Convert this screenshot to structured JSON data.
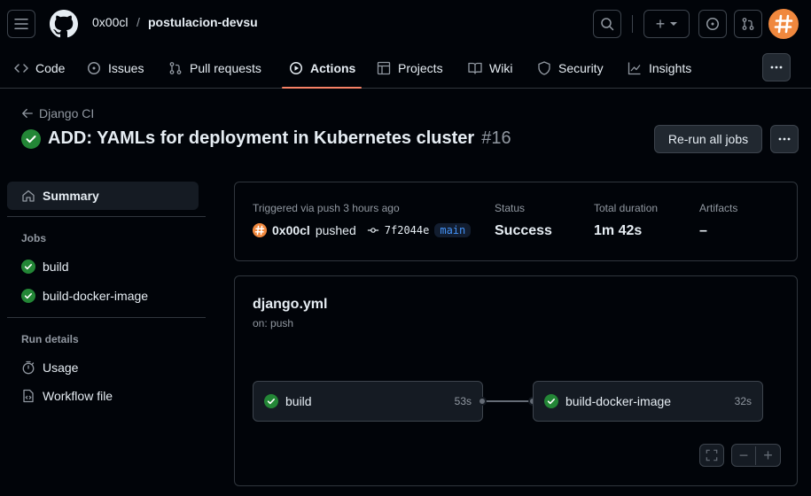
{
  "header": {
    "owner": "0x00cl",
    "separator": "/",
    "repo": "postulacion-devsu",
    "create_label": "+"
  },
  "tabs": [
    {
      "label": "Code",
      "icon": "code-icon"
    },
    {
      "label": "Issues",
      "icon": "issue-opened-icon"
    },
    {
      "label": "Pull requests",
      "icon": "git-pull-request-icon"
    },
    {
      "label": "Actions",
      "icon": "play-icon",
      "active": true
    },
    {
      "label": "Projects",
      "icon": "table-icon"
    },
    {
      "label": "Wiki",
      "icon": "book-icon"
    },
    {
      "label": "Security",
      "icon": "shield-icon"
    },
    {
      "label": "Insights",
      "icon": "graph-icon"
    }
  ],
  "run": {
    "workflow_back": "Django CI",
    "title": "ADD: YAMLs for deployment in Kubernetes cluster",
    "number": "#16",
    "rerun_label": "Re-run all jobs"
  },
  "sidebar": {
    "summary": "Summary",
    "jobs_heading": "Jobs",
    "jobs": [
      "build",
      "build-docker-image"
    ],
    "run_details_heading": "Run details",
    "usage": "Usage",
    "workflow_file": "Workflow file"
  },
  "summary_card": {
    "trigger_text": "Triggered via push 3 hours ago",
    "actor": "0x00cl",
    "action": "pushed",
    "commit": "7f2044e",
    "branch": "main",
    "status_label": "Status",
    "status_value": "Success",
    "duration_label": "Total duration",
    "duration_value": "1m 42s",
    "artifacts_label": "Artifacts",
    "artifacts_value": "–"
  },
  "workflow_graph": {
    "file": "django.yml",
    "trigger": "on: push",
    "jobs": [
      {
        "name": "build",
        "duration": "53s"
      },
      {
        "name": "build-docker-image",
        "duration": "32s"
      }
    ],
    "zoom_out": "−",
    "zoom_in": "+"
  },
  "colors": {
    "accent_orange": "#f78166",
    "success_green": "#238636",
    "link_blue": "#4493f8",
    "avatar_orange": "#f0883e"
  }
}
